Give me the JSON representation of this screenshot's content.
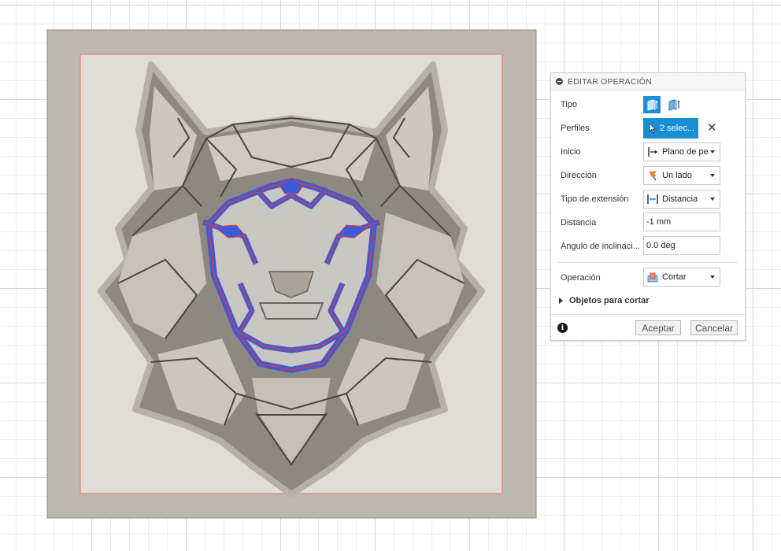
{
  "panel": {
    "title": "EDITAR OPERACIÓN",
    "rows": {
      "tipo": {
        "label": "Tipo"
      },
      "perfiles": {
        "label": "Perfiles",
        "value": "2 selec..."
      },
      "inicio": {
        "label": "Inicio",
        "value": "Plano de pe..."
      },
      "direccion": {
        "label": "Dirección",
        "value": "Un lado"
      },
      "tipo_extension": {
        "label": "Tipo de extensión",
        "value": "Distancia"
      },
      "distancia": {
        "label": "Distancia",
        "value": "-1 mm"
      },
      "angulo": {
        "label": "Ángulo de inclinaci...",
        "value": "0.0 deg"
      },
      "operacion": {
        "label": "Operación",
        "value": "Cortar"
      }
    },
    "objetos_label": "Objetos para cortar",
    "buttons": {
      "ok": "Aceptar",
      "cancel": "Cancelar"
    }
  },
  "colors": {
    "accent": "#1a8fd3",
    "plate": "#bdb8ae",
    "face": "#e0ddd6",
    "sketch": "#e53935",
    "selection": "#3d5bd6"
  },
  "icons": {
    "collapse": "minus-circle-icon",
    "tipo_solid": "solid-extrude-icon",
    "tipo_surface": "surface-extrude-icon",
    "perfiles": "cursor-arrow-icon",
    "clear": "close-icon",
    "inicio": "profile-plane-icon",
    "direccion": "flag-icon",
    "extension": "distance-icon",
    "operacion": "cut-icon",
    "info": "info-icon"
  }
}
